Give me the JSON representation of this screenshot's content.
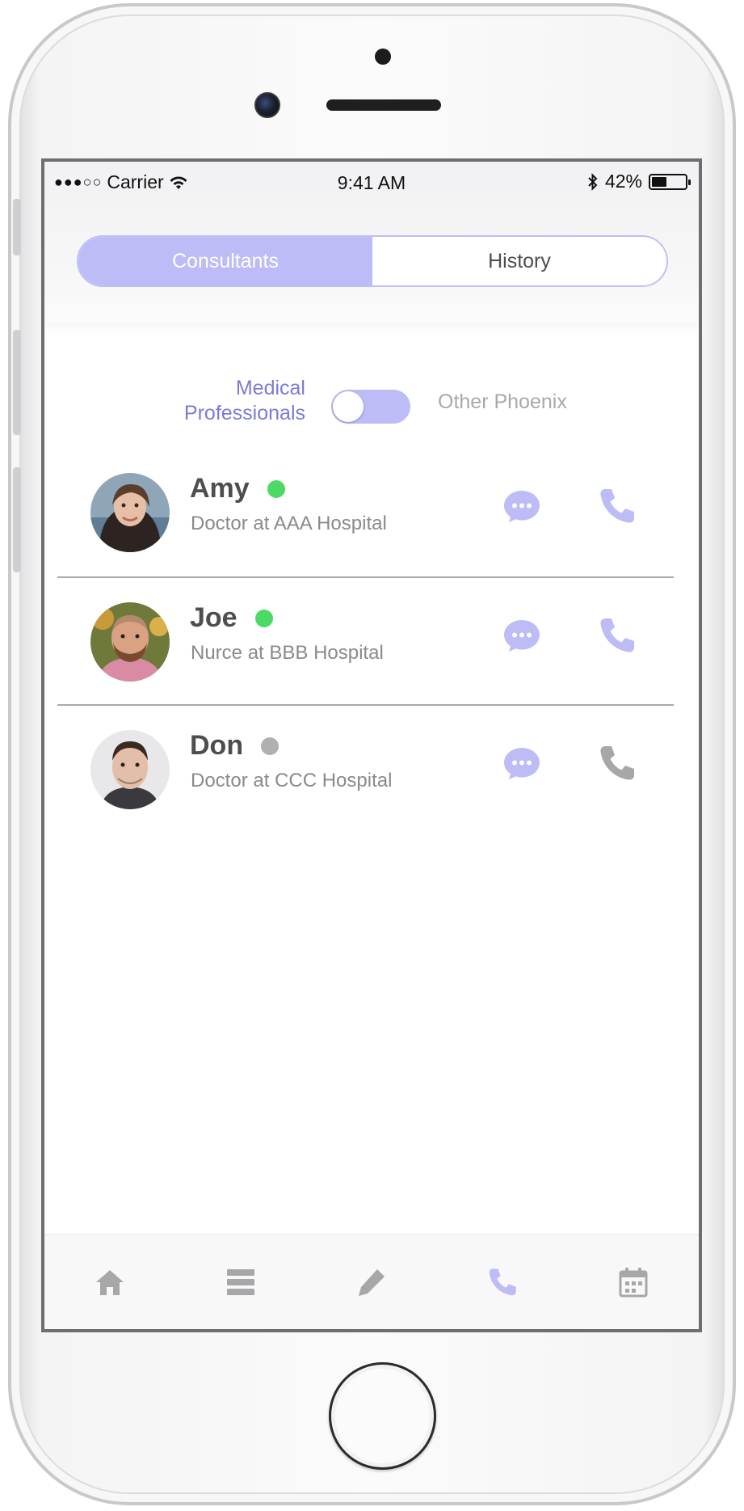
{
  "status_bar": {
    "signal": "●●●○○",
    "carrier": "Carrier",
    "wifi_icon": "wifi-icon",
    "time": "9:41 AM",
    "bluetooth_icon": "bluetooth-icon",
    "battery": "42%",
    "battery_level": 0.42
  },
  "segmented": {
    "active": "Consultants",
    "inactive": "History"
  },
  "filter": {
    "left_line1": "Medical",
    "left_line2": "Professionals",
    "right": "Other Phoenix",
    "state": "left"
  },
  "consultants": [
    {
      "name": "Amy",
      "title": "Doctor at AAA Hospital",
      "status": "online",
      "status_color": "#4cd964",
      "chat_icon": "chat-bubble-icon",
      "call_icon": "phone-icon",
      "call_enabled": true
    },
    {
      "name": "Joe",
      "title": "Nurce at BBB Hospital",
      "status": "online",
      "status_color": "#4cd964",
      "chat_icon": "chat-bubble-icon",
      "call_icon": "phone-icon",
      "call_enabled": true
    },
    {
      "name": "Don",
      "title": "Doctor at CCC Hospital",
      "status": "offline",
      "status_color": "#b0b0b0",
      "chat_icon": "chat-bubble-icon",
      "call_icon": "phone-icon",
      "call_enabled": false
    }
  ],
  "tab_bar": {
    "items": [
      "home-icon",
      "list-icon",
      "pencil-icon",
      "phone-icon",
      "calendar-icon"
    ],
    "active": "phone-icon"
  },
  "colors": {
    "accent": "#bdbcf6",
    "accent_text": "#7b7ad8",
    "online": "#4cd964",
    "offline": "#b0b0b0",
    "icon_inactive": "#a7a7a9"
  }
}
